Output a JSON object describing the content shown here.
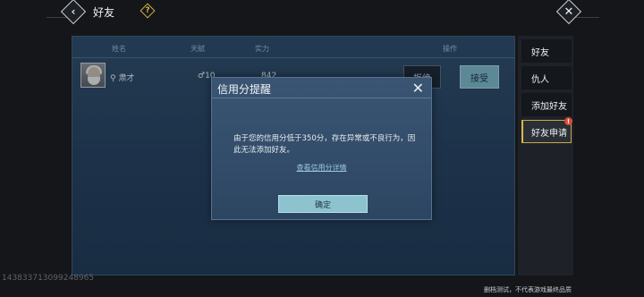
{
  "topbar": {
    "title": "好友"
  },
  "table": {
    "headers": [
      "姓名",
      "天赋",
      "实力",
      "操作"
    ],
    "row": {
      "name": "肃才",
      "talent": "10",
      "power": "842",
      "reject_label": "拒绝",
      "accept_label": "接受"
    }
  },
  "sidebar": {
    "items": [
      {
        "label": "好友"
      },
      {
        "label": "仇人"
      },
      {
        "label": "添加好友"
      },
      {
        "label": "好友申请",
        "badge": "!"
      }
    ]
  },
  "dialog": {
    "title": "信用分提醒",
    "message": "由于您的信用分低于350分，存在异常或不良行为，因此无法添加好友。",
    "link": "查看信用分详情",
    "ok_label": "确定"
  },
  "footer": {
    "id_watermark": "143833713099248965",
    "disclaimer": "删档测试，不代表游戏最终品质"
  },
  "colors": {
    "accent_gold": "#d7b441",
    "badge_red": "#d84a3a",
    "accept_teal": "#7db4c3"
  }
}
